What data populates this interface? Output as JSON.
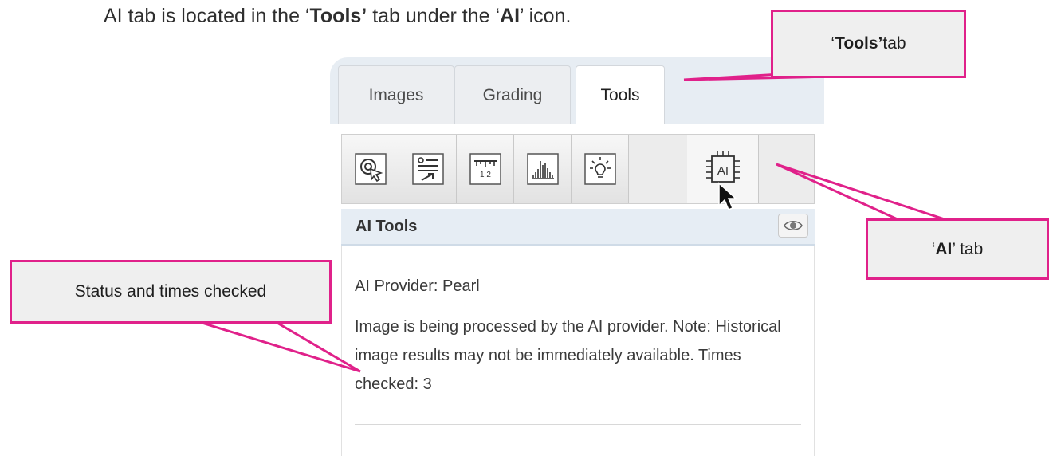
{
  "intro": {
    "before_tools": "AI tab is located in the ‘",
    "tools_word": "Tools’",
    "between": " tab under the ‘",
    "ai_word": "AI",
    "after": "’ icon."
  },
  "tabs": [
    {
      "label": "Images",
      "active": false
    },
    {
      "label": "Grading",
      "active": false
    },
    {
      "label": "Tools",
      "active": true
    }
  ],
  "toolbar": {
    "icons": [
      "select-pointer-icon",
      "annotation-list-icon",
      "ruler-measure-icon",
      "histogram-icon",
      "lightbulb-icon",
      "ai-chip-icon"
    ],
    "active_index": 5
  },
  "section": {
    "title": "AI Tools",
    "toggle_icon": "eye-icon"
  },
  "content": {
    "provider": "AI Provider: Pearl",
    "status": "Image is being processed by the AI provider. Note: Historical image results may not be immediately available. Times checked: 3"
  },
  "callouts": {
    "tools_open": "‘",
    "tools_bold": "Tools’",
    "tools_rest": " tab",
    "ai_open": "‘",
    "ai_bold": "AI",
    "ai_rest": "’ tab",
    "status": "Status and times checked"
  },
  "colors": {
    "callout_border": "#e0218a",
    "callout_fill": "#efefef",
    "tab_bar": "#e7edf3"
  }
}
